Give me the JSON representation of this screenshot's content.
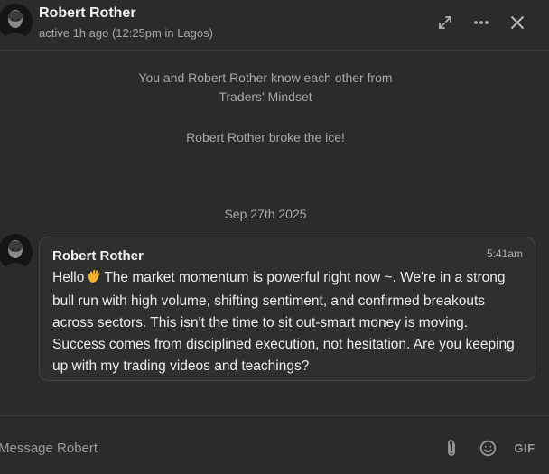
{
  "header": {
    "name": "Robert Rother",
    "status": "active 1h ago (12:25pm in Lagos)",
    "icons": [
      "expand-icon",
      "more-icon",
      "close-icon"
    ]
  },
  "system": {
    "mutual_line1": "You and Robert Rother know each other from",
    "mutual_line2": "Traders' Mindset",
    "icebreaker": "Robert Rother broke the ice!",
    "date_divider": "Sep 27th 2025"
  },
  "message": {
    "sender": "Robert Rother",
    "time": "5:41am",
    "greeting": "Hello",
    "emoji": "waving-hand",
    "body": "The market momentum is powerful right now ~. We're in a strong bull run with high volume, shifting sentiment, and confirmed breakouts across sectors. This isn't the time to sit out-smart money is moving. Success comes from disciplined execution, not hesitation. Are you keeping up with my trading videos and teachings?"
  },
  "composer": {
    "placeholder": "Message Robert",
    "gif_label": "GIF",
    "icons": [
      "attach-icon",
      "emoji-icon",
      "gif-icon"
    ]
  }
}
